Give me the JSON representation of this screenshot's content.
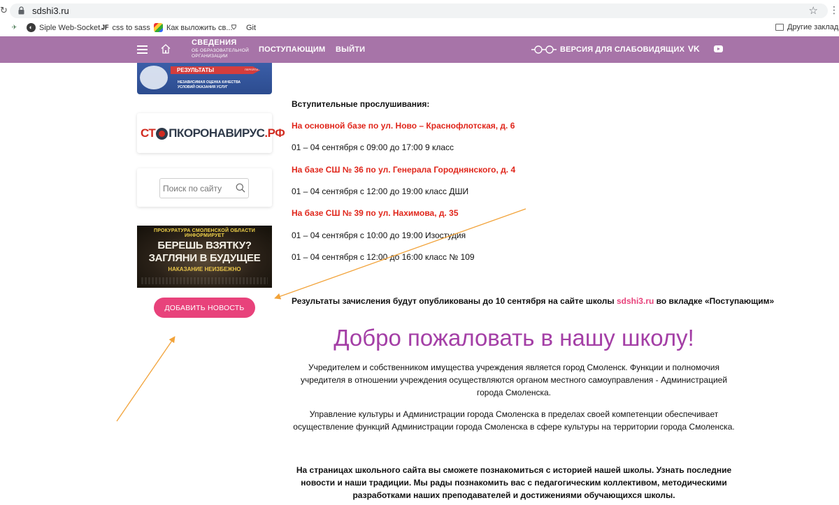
{
  "browser": {
    "url": "sdshi3.ru",
    "bookmarks": [
      {
        "icon": "bird-icon",
        "label": "Siple Web-Socket..."
      },
      {
        "icon": "jf-icon",
        "label": "css to sass"
      },
      {
        "icon": "colorful-square-icon",
        "label": "Как выложить св..."
      },
      {
        "icon": "git-shield-icon",
        "label": "Git"
      }
    ],
    "other_bookmarks": "Другие закладки"
  },
  "nav": {
    "info_title": "СВЕДЕНИЯ",
    "info_sub": "ОБ ОБРАЗОВАТЕЛЬНОЙ ОРГАНИЗАЦИИ",
    "applicants": "ПОСТУПАЮЩИМ",
    "logout": "ВЫЙТИ",
    "low_vision": "ВЕРСИЯ ДЛЯ СЛАБОВИДЯЩИХ",
    "vk": "VK",
    "accent_color": "#a774a8"
  },
  "sidebar": {
    "results_banner": {
      "title": "РЕЗУЛЬТАТЫ",
      "tag": "ПЕРЕЙТИ...",
      "line1": "НЕЗАВИСИМАЯ ОЦЕНКА КАЧЕСТВА",
      "line2": "УСЛОВИЙ ОКАЗАНИЯ УСЛУГ"
    },
    "stop_banner": {
      "part1": "СТ",
      "part2": "П",
      "part3": "КОРОНАВИРУС",
      "part4": ".РФ"
    },
    "search_placeholder": "Поиск по сайту",
    "prokuratura": {
      "top": "ПРОКУРАТУРА СМОЛЕНСКОЙ ОБЛАСТИ ИНФОРМИРУЕТ",
      "line1": "БЕРЕШЬ ВЗЯТКУ?",
      "line2": "ЗАГЛЯНИ В БУДУЩЕЕ",
      "line3": "НАКАЗАНИЕ НЕИЗБЕЖНО"
    },
    "add_news": "ДОБАВИТЬ НОВОСТЬ",
    "add_news_color": "#e8427b"
  },
  "main": {
    "auditions_title": "Вступительные прослушивания:",
    "loc1": "На основной базе по ул. Ново – Краснофлотская, д. 6",
    "sched1": "01 – 04 сентября с 09:00 до 17:00 9 класс",
    "loc2": "На базе СШ № 36 по ул. Генерала Городнянского, д. 4",
    "sched2": "01 – 04 сентября с 12:00 до 19:00 класс ДШИ",
    "loc3": "На базе СШ № 39 по ул. Нахимова, д. 35",
    "sched3": "01 – 04 сентября с 10:00 до 19:00 Изостудия",
    "sched4": "01 – 04 сентября с 12:00 до 16:00 класс № 109",
    "results_before": "Результаты зачисления будут опубликованы до 10 сентября на сайте школы ",
    "results_link": "sdshi3.ru",
    "results_after": " во вкладке «Поступающим»",
    "welcome": "Добро пожаловать в нашу школу!",
    "para1": "Учредителем и собственником имущества учреждения является город Смоленск. Функции и полномочия учредителя в отношении учреждения осуществляются органом местного самоуправления - Администрацией города Смоленска.",
    "para2": "Управление культуры и Администрации города Смоленска в пределах своей компетенции обеспечивает осуществление функций Администрации города Смоленска в сфере культуры на территории города Смоленска.",
    "para3": "На страницах школьного сайта вы сможете познакомиться с историей нашей школы. Узнать последние новости и наши традиции. Мы рады познакомить вас с педагогическим коллективом, методическими разработками наших преподавателей и достижениями обучающихся школы.",
    "title_color": "#a43fa6",
    "location_color": "#e0261b"
  },
  "annotation": {
    "arrow_color": "#f2a33a"
  }
}
